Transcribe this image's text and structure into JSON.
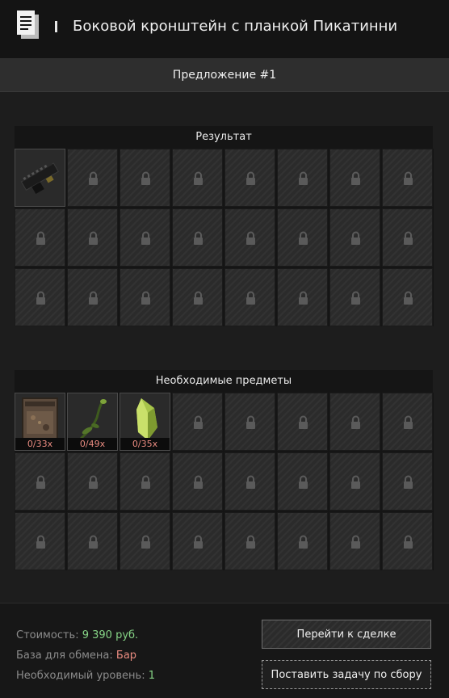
{
  "header": {
    "title": "Боковой кронштейн с планкой Пикатинни",
    "icon": "document-icon"
  },
  "offer": {
    "label": "Предложение #1"
  },
  "result_section": {
    "title": "Результат",
    "rows": 3,
    "columns": 8,
    "items": [
      {
        "name": "picatinny-side-mount",
        "icon": "picatinny-mount-icon",
        "quantity": ""
      }
    ]
  },
  "required_section": {
    "title": "Необходимые предметы",
    "rows": 3,
    "columns": 8,
    "items": [
      {
        "name": "rusty-canister",
        "icon": "canister-icon",
        "quantity": "0/33x"
      },
      {
        "name": "green-sprout",
        "icon": "sprout-icon",
        "quantity": "0/49x"
      },
      {
        "name": "green-crystal",
        "icon": "crystal-icon",
        "quantity": "0/35x"
      }
    ]
  },
  "footer": {
    "cost_label": "Стоимость:",
    "cost_value": "9 390 руб.",
    "base_label": "База для обмена:",
    "base_value": "Бар",
    "level_label": "Необходимый уровень:",
    "level_value": "1",
    "trade_button": "Перейти к сделке",
    "task_button": "Поставить задачу по сбору"
  },
  "colors": {
    "cost_value": "#86d486",
    "base_value": "#e98b80",
    "level_value": "#86d486",
    "quantity_missing": "#e98b80",
    "background": "#1d1d1d"
  }
}
